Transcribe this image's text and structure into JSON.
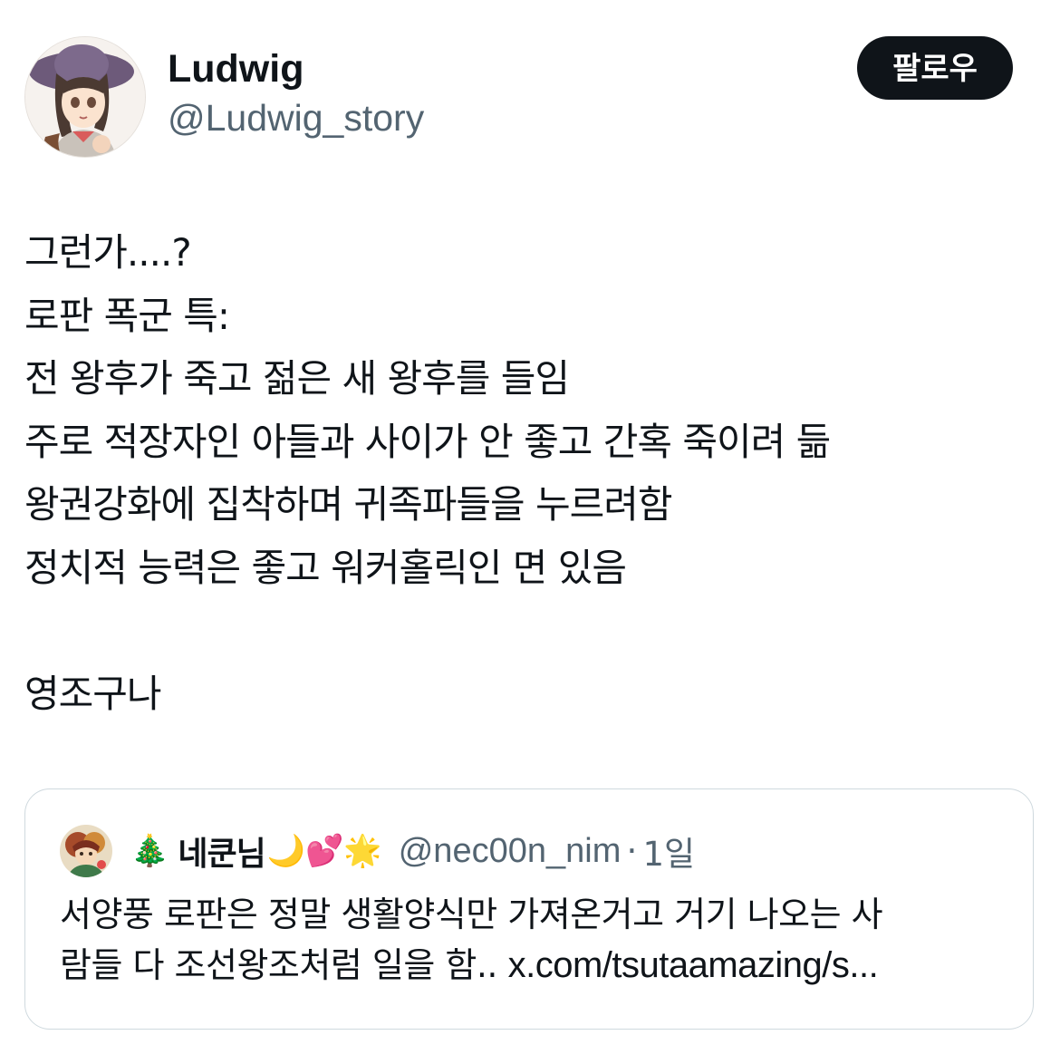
{
  "author": {
    "display_name": "Ludwig",
    "handle": "@Ludwig_story",
    "avatar_icon": "profile-avatar-icon"
  },
  "follow_label": "팔로우",
  "tweet_lines": [
    "그런가....?",
    "로판 폭군 특:",
    "전 왕후가 죽고 젊은 새 왕후를 들임",
    "주로 적장자인 아들과 사이가 안 좋고 간혹 죽이려 듦",
    "왕권강화에 집착하며 귀족파들을 누르려함",
    "정치적 능력은 좋고 워커홀릭인 면 있음",
    "",
    "영조구나"
  ],
  "quote": {
    "emoji_before": "🎄",
    "display_name": "네쿤님",
    "emoji_after": "🌙💕🌟",
    "handle": "@nec00n_nim",
    "separator": "·",
    "time": "1일",
    "text_line1": "서양풍 로판은 정말 생활양식만 가져온거고 거기 나오는 사",
    "text_line2_prefix": "람들 다 조선왕조처럼 일을 함.. ",
    "text_line2_link": "x.com/tsutaamazing/s..."
  },
  "colors": {
    "text_primary": "#0f1419",
    "text_secondary": "#536471",
    "border": "#cfd9de",
    "button_bg": "#0f1419"
  }
}
